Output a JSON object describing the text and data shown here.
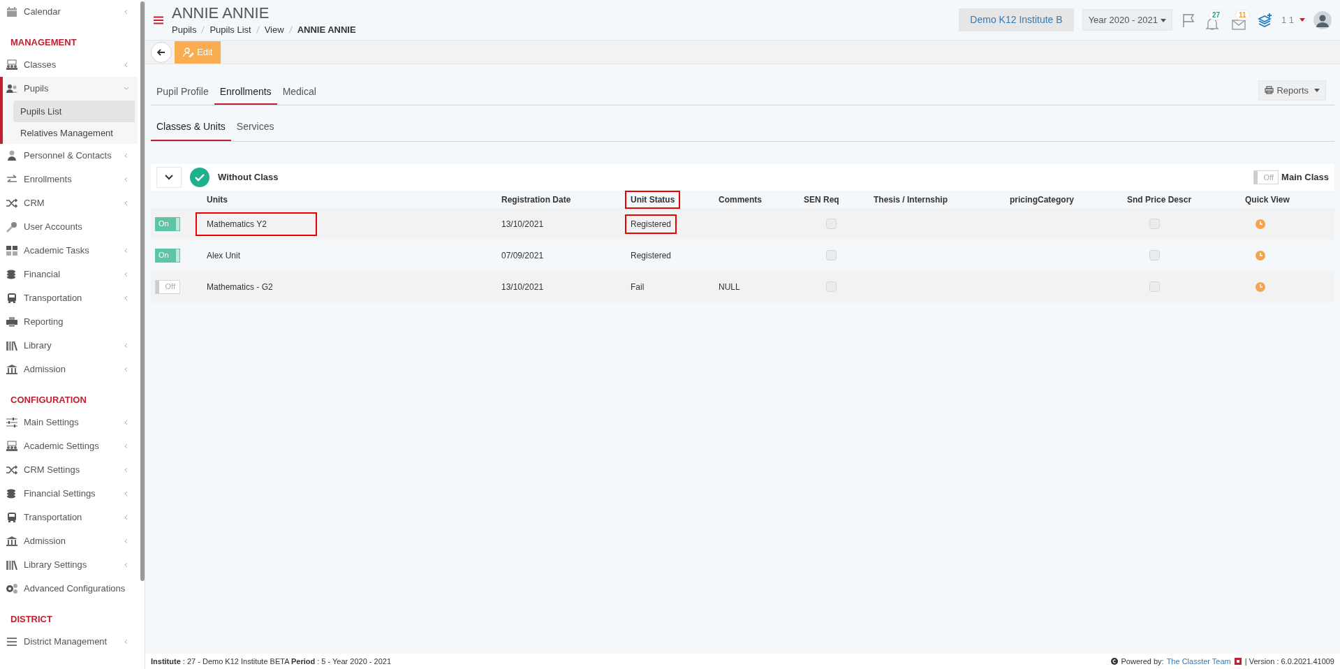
{
  "sidebar": {
    "items": [
      {
        "kind": "item",
        "label": "Calendar",
        "expandable": true,
        "selected": false
      },
      {
        "kind": "section",
        "label": "MANAGEMENT"
      },
      {
        "kind": "item",
        "label": "Classes",
        "expandable": true,
        "selected": false
      },
      {
        "kind": "item",
        "label": "Pupils",
        "expandable": true,
        "selected": true,
        "expanded": true,
        "children": [
          {
            "label": "Pupils List",
            "selected": true
          },
          {
            "label": "Relatives Management",
            "selected": false
          }
        ]
      },
      {
        "kind": "item",
        "label": "Personnel & Contacts",
        "expandable": true,
        "selected": false
      },
      {
        "kind": "item",
        "label": "Enrollments",
        "expandable": true,
        "selected": false
      },
      {
        "kind": "item",
        "label": "CRM",
        "expandable": true,
        "selected": false
      },
      {
        "kind": "item",
        "label": "User Accounts",
        "expandable": false,
        "selected": false
      },
      {
        "kind": "item",
        "label": "Academic Tasks",
        "expandable": true,
        "selected": false
      },
      {
        "kind": "item",
        "label": "Financial",
        "expandable": true,
        "selected": false
      },
      {
        "kind": "item",
        "label": "Transportation",
        "expandable": true,
        "selected": false
      },
      {
        "kind": "item",
        "label": "Reporting",
        "expandable": false,
        "selected": false
      },
      {
        "kind": "item",
        "label": "Library",
        "expandable": true,
        "selected": false
      },
      {
        "kind": "item",
        "label": "Admission",
        "expandable": true,
        "selected": false
      },
      {
        "kind": "section",
        "label": "CONFIGURATION"
      },
      {
        "kind": "item",
        "label": "Main Settings",
        "expandable": true,
        "selected": false
      },
      {
        "kind": "item",
        "label": "Academic Settings",
        "expandable": true,
        "selected": false
      },
      {
        "kind": "item",
        "label": "CRM Settings",
        "expandable": true,
        "selected": false
      },
      {
        "kind": "item",
        "label": "Financial Settings",
        "expandable": true,
        "selected": false
      },
      {
        "kind": "item",
        "label": "Transportation",
        "expandable": true,
        "selected": false
      },
      {
        "kind": "item",
        "label": "Admission",
        "expandable": true,
        "selected": false
      },
      {
        "kind": "item",
        "label": "Library Settings",
        "expandable": true,
        "selected": false
      },
      {
        "kind": "item",
        "label": "Advanced Configurations",
        "expandable": false,
        "selected": false
      },
      {
        "kind": "section",
        "label": "DISTRICT"
      },
      {
        "kind": "item",
        "label": "District Management",
        "expandable": true,
        "selected": false
      }
    ]
  },
  "header": {
    "title": "ANNIE ANNIE",
    "breadcrumb": [
      "Pupils",
      "Pupils List",
      "View",
      "ANNIE ANNIE"
    ],
    "institute": "Demo K12 Institute B",
    "year": "Year 2020 - 2021",
    "notifications": "27",
    "messages": "11",
    "user": "1 1"
  },
  "toolbar": {
    "edit": "Edit"
  },
  "tabs": [
    {
      "label": "Pupil Profile",
      "selected": false
    },
    {
      "label": "Enrollments",
      "selected": true
    },
    {
      "label": "Medical",
      "selected": false
    }
  ],
  "reports": "Reports",
  "subtabs": [
    {
      "label": "Classes & Units",
      "selected": true
    },
    {
      "label": "Services",
      "selected": false
    }
  ],
  "group": {
    "title": "Without Class",
    "main_class": {
      "label": "Main Class",
      "toggle": "Off",
      "on": false
    }
  },
  "table": {
    "columns": [
      {
        "label": "Units",
        "marked": false
      },
      {
        "label": "Registration Date",
        "marked": false
      },
      {
        "label": "Unit Status",
        "marked": true
      },
      {
        "label": "Comments",
        "marked": false
      },
      {
        "label": "SEN Req",
        "marked": false
      },
      {
        "label": "Thesis / Internship",
        "marked": false
      },
      {
        "label": "pricingCategory",
        "marked": false
      },
      {
        "label": "Snd Price Descr",
        "marked": false
      },
      {
        "label": "Quick View",
        "marked": false
      }
    ],
    "rows": [
      {
        "toggle": "On",
        "on": true,
        "unit": "Mathematics Y2",
        "unit_marked": true,
        "registration_date": "13/10/2021",
        "status": "Registered",
        "status_marked": true,
        "sen_req": false,
        "snd_price": false
      },
      {
        "toggle": "On",
        "on": true,
        "unit": "Alex Unit",
        "unit_marked": false,
        "registration_date": "07/09/2021",
        "status": "Registered",
        "status_marked": false,
        "sen_req": false,
        "snd_price": false
      },
      {
        "toggle": "Off",
        "on": false,
        "unit": "Mathematics - G2",
        "unit_marked": false,
        "registration_date": "13/10/2021",
        "status": "Fail",
        "status_marked": false,
        "comments": "NULL",
        "sen_req": false,
        "snd_price": false
      }
    ]
  },
  "footer": {
    "info": "**Institute** : 27 - Demo K12 Institute BETA **Period** : 5 - Year 2020 - 2021",
    "powered": "Powered by:",
    "team": "The Classter Team",
    "version": "| Version : 6.0.2021.41009"
  }
}
